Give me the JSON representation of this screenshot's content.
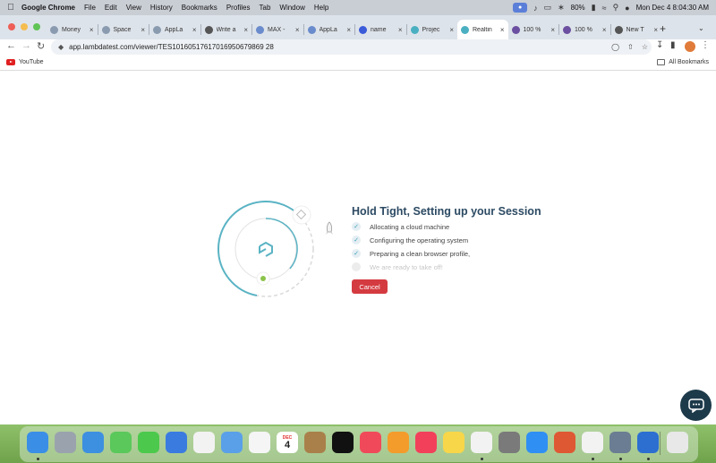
{
  "menubar": {
    "app_name": "Google Chrome",
    "items": [
      "File",
      "Edit",
      "View",
      "History",
      "Bookmarks",
      "Profiles",
      "Tab",
      "Window",
      "Help"
    ],
    "battery": "80%",
    "datetime": "Mon Dec 4  8:04:30 AM"
  },
  "tabs": [
    {
      "title": "Money",
      "favicon_color": "#8a9bb0"
    },
    {
      "title": "Space",
      "favicon_color": "#8a9bb0"
    },
    {
      "title": "AppLa",
      "favicon_color": "#8a9bb0"
    },
    {
      "title": "Write a",
      "favicon_color": "#555555"
    },
    {
      "title": "MAX -",
      "favicon_color": "#6a8ccc"
    },
    {
      "title": "AppLa",
      "favicon_color": "#6a8ccc"
    },
    {
      "title": "name",
      "favicon_color": "#3b5bd9"
    },
    {
      "title": "Projec",
      "favicon_color": "#4ab0c1"
    },
    {
      "title": "Realtin",
      "favicon_color": "#4ab0c1",
      "active": true
    },
    {
      "title": "100 %",
      "favicon_color": "#6b4fa0"
    },
    {
      "title": "100 %",
      "favicon_color": "#6b4fa0"
    },
    {
      "title": "New T",
      "favicon_color": "#555555"
    }
  ],
  "toolbar": {
    "url": "app.lambdatest.com/viewer/TES10160517617016950679869 28"
  },
  "bookmarks": {
    "youtube": "YouTube",
    "all_bookmarks": "All Bookmarks"
  },
  "session": {
    "heading": "Hold Tight, Setting up your Session",
    "steps": [
      {
        "label": "Allocating a cloud machine",
        "done": true
      },
      {
        "label": "Configuring the operating system",
        "done": true
      },
      {
        "label": "Preparing a clean browser profile,",
        "done": true
      },
      {
        "label": "We are ready to take off!",
        "done": false
      }
    ],
    "cancel_label": "Cancel"
  },
  "dock": {
    "calendar_month": "DEC",
    "calendar_day": "4",
    "icons": [
      "finder-icon",
      "launchpad-icon",
      "safari-icon",
      "messages-icon",
      "facetime-icon",
      "mail-icon",
      "reminders-icon",
      "maps-icon",
      "photos-icon",
      "calendar-icon",
      "contacts-icon",
      "appletv-icon",
      "news-icon",
      "books-icon",
      "music-icon",
      "notes-icon",
      "freeform-icon",
      "system-settings-icon",
      "app-store-icon",
      "duckduckgo-icon",
      "chrome-icon",
      "preview-icon",
      "xcode-icon",
      "trash-icon"
    ]
  }
}
